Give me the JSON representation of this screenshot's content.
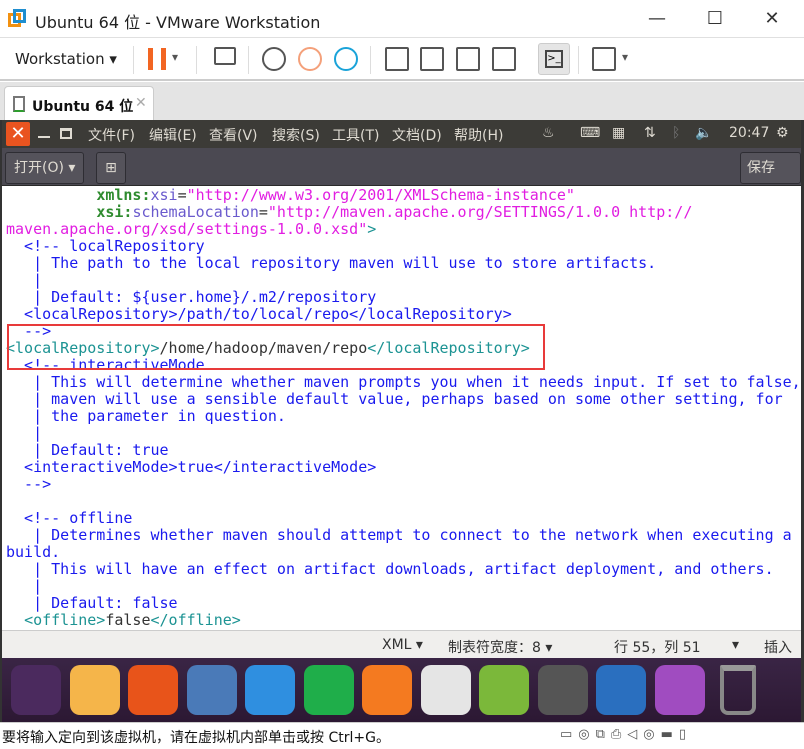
{
  "window": {
    "title": "Ubuntu 64 位 - VMware Workstation"
  },
  "toolbar": {
    "workstation_menu": "Workstation"
  },
  "tab": {
    "label": "Ubuntu 64 位"
  },
  "ubuntu": {
    "menus": [
      "文件(F)",
      "编辑(E)",
      "查看(V)",
      "搜索(S)",
      "工具(T)",
      "文档(D)",
      "帮助(H)"
    ],
    "clock": "20:47"
  },
  "gedit": {
    "open_label": "打开(O)",
    "save_label": "保存(S)"
  },
  "code_lines": [
    [
      [
        "txt",
        "          "
      ],
      [
        "attr",
        "xmlns:"
      ],
      [
        "ns",
        "xsi"
      ],
      [
        "txt",
        "="
      ],
      [
        "str",
        "\"http://www.w3.org/2001/XMLSchema-instance\""
      ]
    ],
    [
      [
        "txt",
        "          "
      ],
      [
        "attr",
        "xsi:"
      ],
      [
        "ns",
        "schemaLocation"
      ],
      [
        "txt",
        "="
      ],
      [
        "str",
        "\"http://maven.apache.org/SETTINGS/1.0.0 http://"
      ]
    ],
    [
      [
        "str",
        "maven.apache.org/xsd/settings-1.0.0.xsd\""
      ],
      [
        "tag",
        ">"
      ]
    ],
    [
      [
        "cm",
        "  <!-- localRepository"
      ]
    ],
    [
      [
        "cm",
        "   | The path to the local repository maven will use to store artifacts."
      ]
    ],
    [
      [
        "cm",
        "   |"
      ]
    ],
    [
      [
        "cm",
        "   | Default: ${user.home}/.m2/repository"
      ]
    ],
    [
      [
        "cm",
        "  <localRepository>/path/to/local/repo</localRepository>"
      ]
    ],
    [
      [
        "cm",
        "  -->"
      ]
    ],
    [
      [
        "tag",
        "<localRepository>"
      ],
      [
        "txt",
        "/home/hadoop/maven/repo"
      ],
      [
        "tag",
        "</localRepository>"
      ]
    ],
    [
      [
        "cm",
        "  <!-- interactiveMode"
      ]
    ],
    [
      [
        "cm",
        "   | This will determine whether maven prompts you when it needs input. If set to false,"
      ]
    ],
    [
      [
        "cm",
        "   | maven will use a sensible default value, perhaps based on some other setting, for"
      ]
    ],
    [
      [
        "cm",
        "   | the parameter in question."
      ]
    ],
    [
      [
        "cm",
        "   |"
      ]
    ],
    [
      [
        "cm",
        "   | Default: true"
      ]
    ],
    [
      [
        "cm",
        "  <interactiveMode>true</interactiveMode>"
      ]
    ],
    [
      [
        "cm",
        "  -->"
      ]
    ],
    [
      [
        "txt",
        ""
      ]
    ],
    [
      [
        "cm",
        "  <!-- offline"
      ]
    ],
    [
      [
        "cm",
        "   | Determines whether maven should attempt to connect to the network when executing a"
      ]
    ],
    [
      [
        "cm",
        "build."
      ]
    ],
    [
      [
        "cm",
        "   | This will have an effect on artifact downloads, artifact deployment, and others."
      ]
    ],
    [
      [
        "cm",
        "   |"
      ]
    ],
    [
      [
        "cm",
        "   | Default: false"
      ]
    ],
    [
      [
        "cm",
        "  "
      ],
      [
        "tag",
        "<offline>"
      ],
      [
        "txt",
        "false"
      ],
      [
        "tag",
        "</offline>"
      ]
    ]
  ],
  "statusbar": {
    "language": "XML ▾",
    "tab_width": "制表符宽度：8 ▾",
    "position": "行 55，列 51",
    "dropdown": "▾",
    "mode": "插入"
  },
  "dock": [
    "ubuntu-icon",
    "files-icon",
    "firefox-icon",
    "chromium-icon",
    "wps-writer-icon",
    "wps-spreadsheet-icon",
    "wps-presentation-icon",
    "ubuntu-kylin-icon",
    "software-icon",
    "terminal-icon",
    "desktop-icon",
    "gedit-icon",
    "trash-icon"
  ],
  "vmstatus": {
    "message": "要将输入定向到该虚拟机，请在虚拟机内部单击或按 Ctrl+G。"
  },
  "colors": {
    "highlight_box": "#e83a3a",
    "dock": "#2c1833",
    "pause": "#f26522"
  }
}
